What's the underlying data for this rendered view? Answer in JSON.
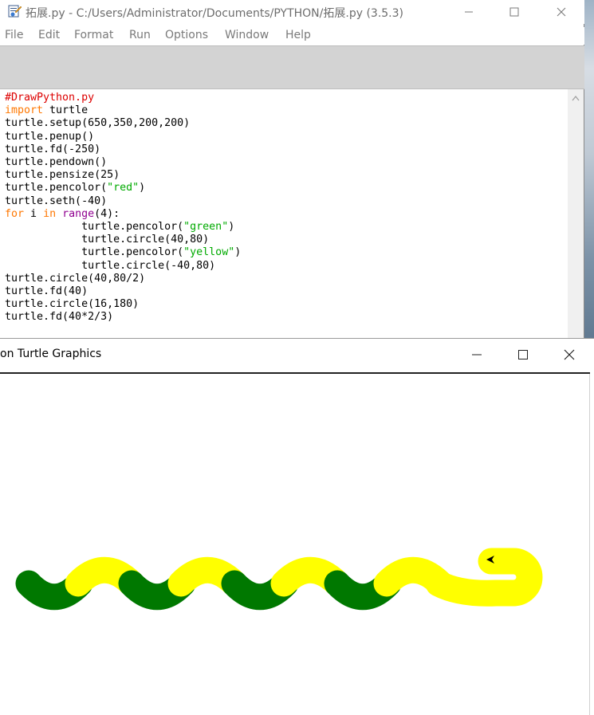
{
  "idle": {
    "title": "拓展.py - C:/Users/Administrator/Documents/PYTHON/拓展.py (3.5.3)",
    "menu": [
      "File",
      "Edit",
      "Format",
      "Run",
      "Options",
      "Window",
      "Help"
    ],
    "code_lines": [
      "#DrawPython.py",
      "import turtle",
      "turtle.setup(650,350,200,200)",
      "turtle.penup()",
      "turtle.fd(-250)",
      "turtle.pendown()",
      "turtle.pensize(25)",
      "turtle.pencolor(\"red\")",
      "turtle.seth(-40)",
      "for i in range(4):",
      "            turtle.pencolor(\"green\")",
      "            turtle.circle(40,80)",
      "            turtle.pencolor(\"yellow\")",
      "            turtle.circle(-40,80)",
      "turtle.circle(40,80/2)",
      "turtle.fd(40)",
      "turtle.circle(16,180)",
      "turtle.fd(40*2/3)"
    ]
  },
  "turtle": {
    "title": "on Turtle Graphics",
    "colors": {
      "green": "#007800",
      "yellow": "#ffff00",
      "head": "#000000"
    }
  },
  "icons": {
    "minimize": "minimize-icon",
    "maximize": "maximize-icon",
    "close": "close-icon",
    "app": "idle-app-icon",
    "scroll_up": "chevron-up-icon"
  }
}
